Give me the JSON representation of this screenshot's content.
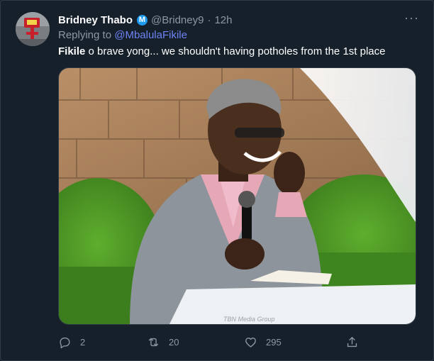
{
  "tweet": {
    "display_name": "Bridney Thabo",
    "badge": "M",
    "handle": "@Bridney9",
    "separator": "·",
    "time": "12h",
    "more_label": "···",
    "replying_prefix": "Replying to",
    "replying_to": "@MbalulaFikile",
    "text_bold": "Fikile",
    "text_rest": " o brave yong... we shouldn't having potholes from the 1st place",
    "media_watermark": "TBN Media Group"
  },
  "actions": {
    "reply": {
      "icon": "reply-icon",
      "count": "2"
    },
    "retweet": {
      "icon": "retweet-icon",
      "count": "20"
    },
    "like": {
      "icon": "heart-icon",
      "count": "295"
    },
    "share": {
      "icon": "share-icon"
    }
  },
  "colors": {
    "background": "#15202b",
    "secondary_text": "#8b98a5",
    "mention": "#6f83f5",
    "verified_blue": "#1d9bf0"
  }
}
